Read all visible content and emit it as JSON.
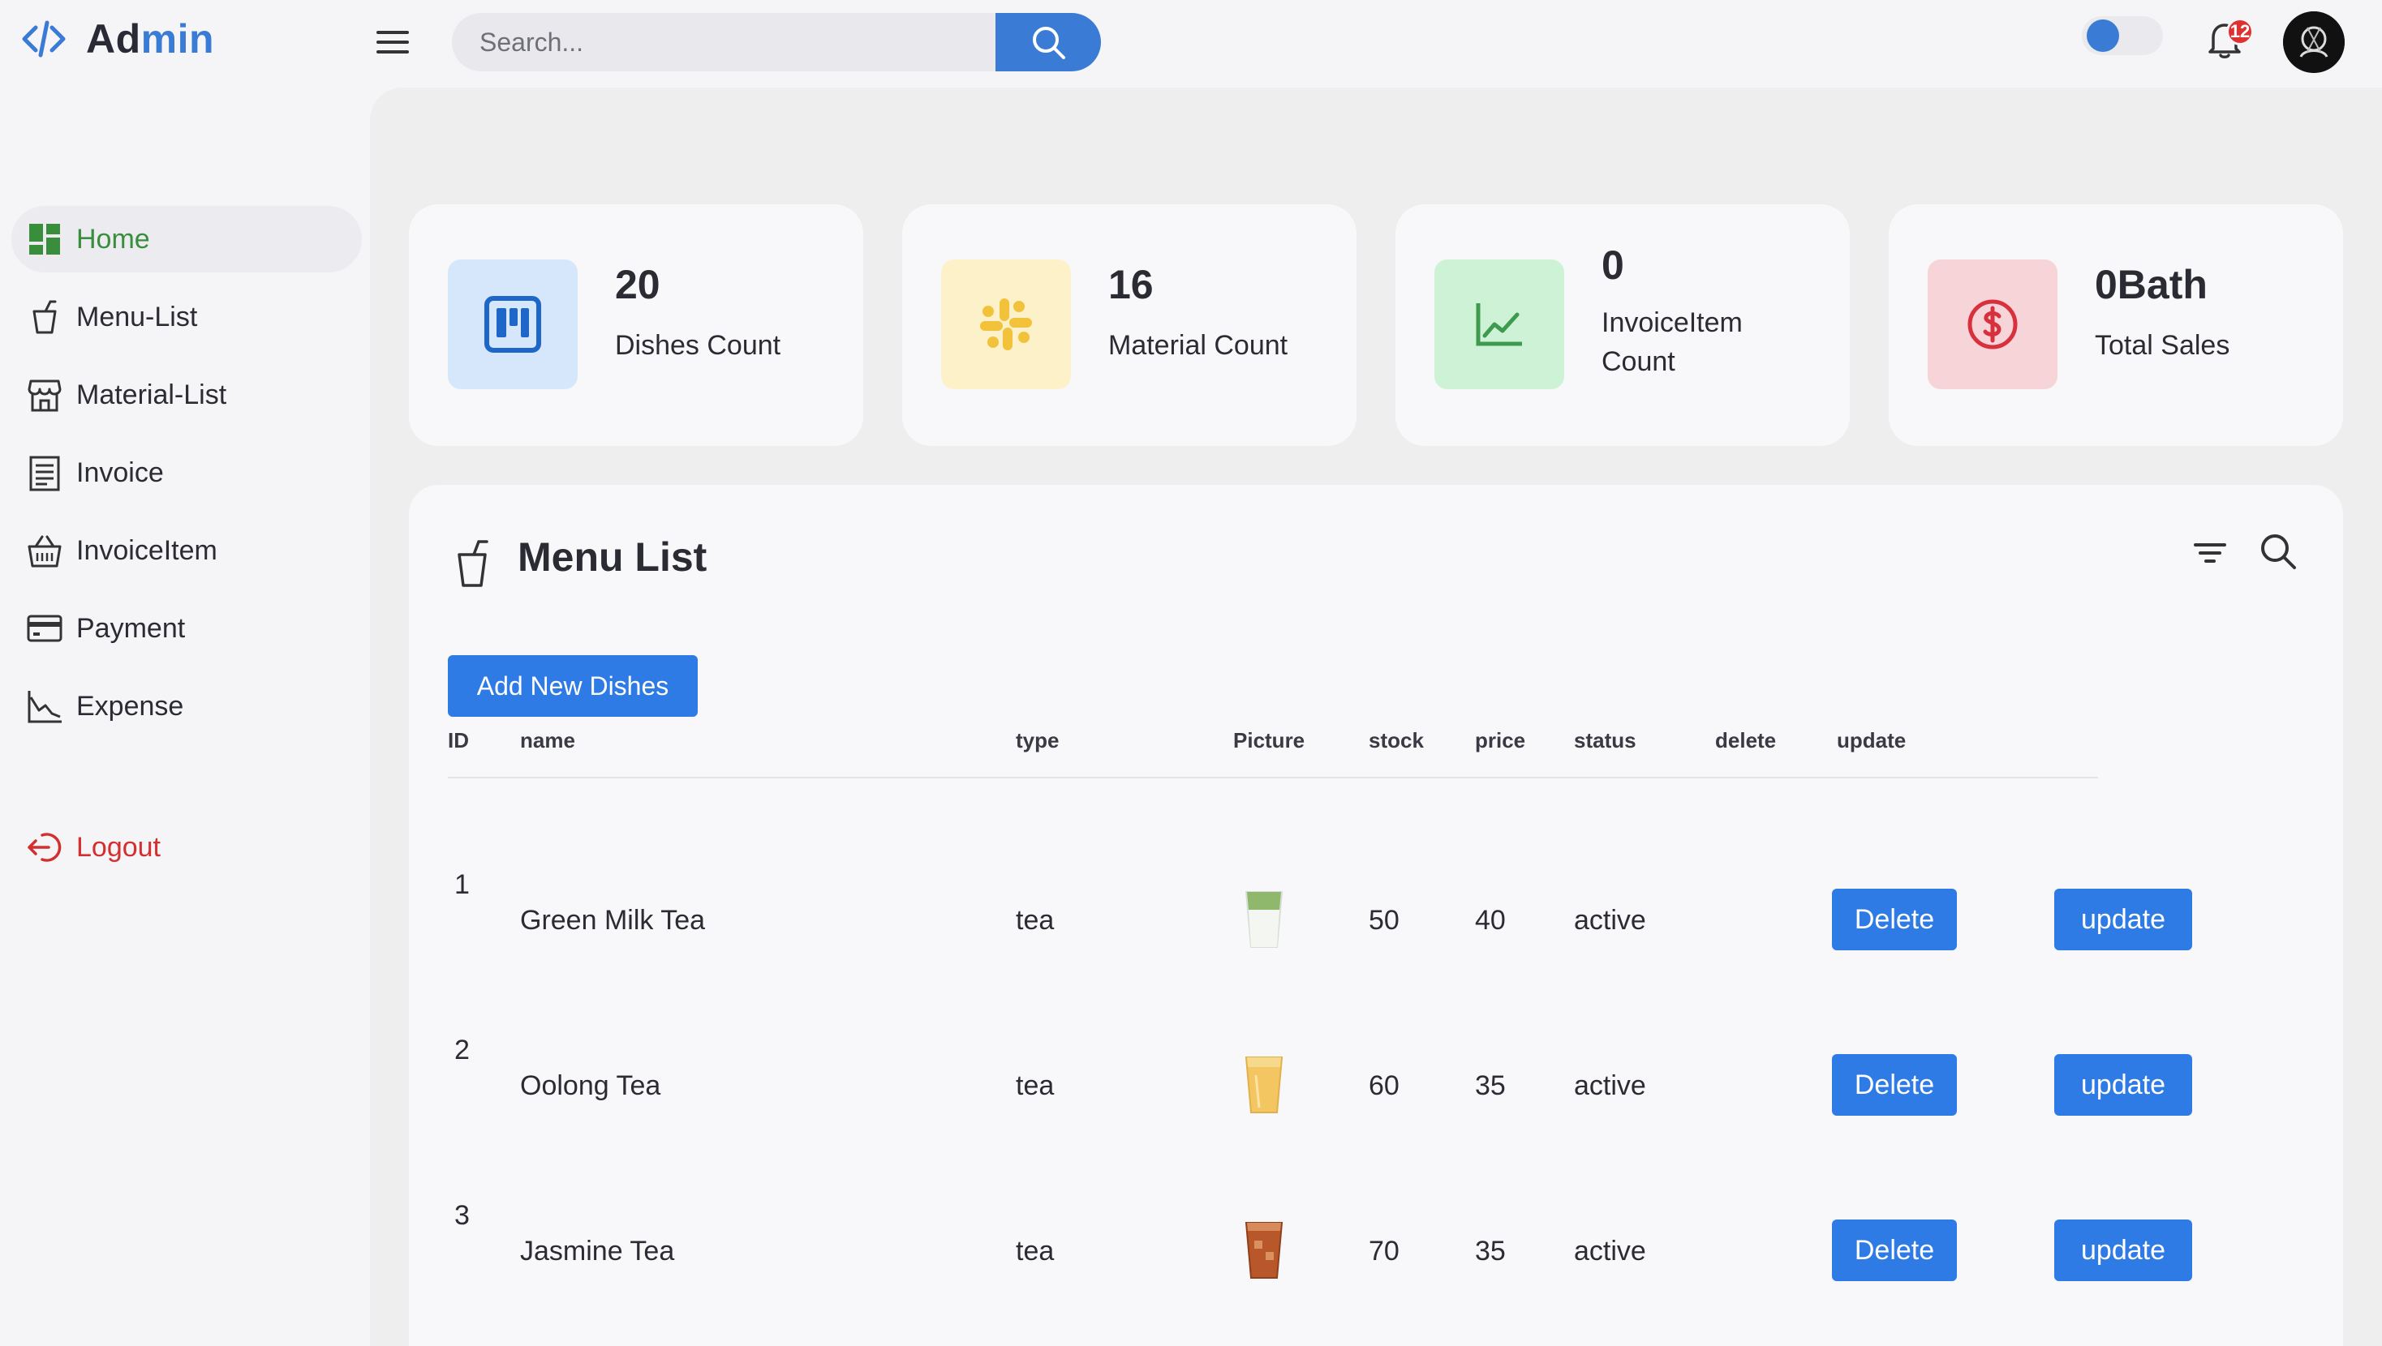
{
  "brand": {
    "part1": "Ad",
    "part2": "min",
    "icon": "code-icon"
  },
  "search": {
    "placeholder": "Search...",
    "value": ""
  },
  "notifications": {
    "count": "12"
  },
  "colors": {
    "accent": "#3a7bd5",
    "active_green": "#388e3c",
    "logout_red": "#d32f2f",
    "button_blue": "#2f7be6"
  },
  "sidebar": {
    "items": [
      {
        "label": "Home",
        "icon": "dashboard-grid-icon",
        "active": true
      },
      {
        "label": "Menu-List",
        "icon": "cup-icon"
      },
      {
        "label": "Material-List",
        "icon": "store-icon"
      },
      {
        "label": "Invoice",
        "icon": "receipt-icon"
      },
      {
        "label": "InvoiceItem",
        "icon": "basket-icon"
      },
      {
        "label": "Payment",
        "icon": "credit-card-icon"
      },
      {
        "label": "Expense",
        "icon": "line-chart-icon"
      }
    ],
    "logout": "Logout"
  },
  "cards": [
    {
      "value": "20",
      "label": "Dishes Count",
      "icon": "board-icon"
    },
    {
      "value": "16",
      "label": "Material Count",
      "icon": "slack-icon"
    },
    {
      "value": "0",
      "label": "InvoiceItem Count",
      "icon": "chart-icon"
    },
    {
      "value": "0Bath",
      "label": "Total Sales",
      "icon": "dollar-icon"
    }
  ],
  "menu_list": {
    "title": "Menu List",
    "add_button": "Add New Dishes",
    "columns": [
      "ID",
      "name",
      "type",
      "Picture",
      "stock",
      "price",
      "status",
      "delete",
      "update"
    ],
    "rows": [
      {
        "id": "1",
        "name": "Green Milk Tea",
        "type": "tea",
        "picture": "green-milk-tea-image",
        "stock": "50",
        "price": "40",
        "status": "active",
        "delete": "Delete",
        "update": "update"
      },
      {
        "id": "2",
        "name": "Oolong Tea",
        "type": "tea",
        "picture": "oolong-tea-image",
        "stock": "60",
        "price": "35",
        "status": "active",
        "delete": "Delete",
        "update": "update"
      },
      {
        "id": "3",
        "name": "Jasmine Tea",
        "type": "tea",
        "picture": "jasmine-tea-image",
        "stock": "70",
        "price": "35",
        "status": "active",
        "delete": "Delete",
        "update": "update"
      }
    ]
  }
}
